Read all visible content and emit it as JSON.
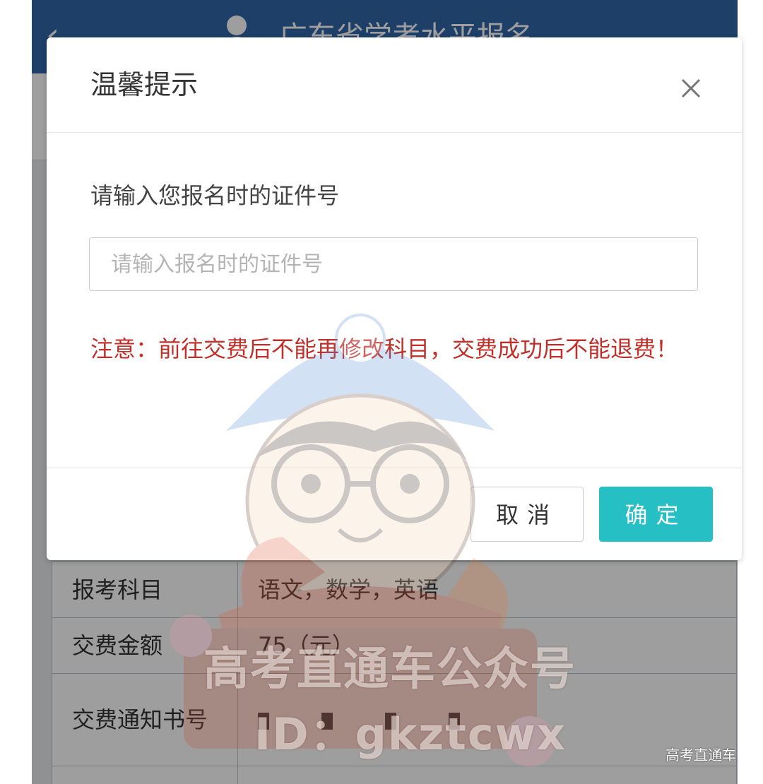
{
  "app": {
    "back_glyph": "‹",
    "title": "广东省学考水平报名"
  },
  "table": {
    "rows": [
      {
        "label": "报考科目",
        "value": "语文，数学，英语"
      },
      {
        "label": "交费金额",
        "value": "75（元）"
      },
      {
        "label": "交费通知书号",
        "value": ""
      }
    ]
  },
  "dialog": {
    "title": "温馨提示",
    "close_icon": "close-icon",
    "prompt": "请输入您报名时的证件号",
    "input_value": "",
    "input_placeholder": "请输入报名时的证件号",
    "warning": "注意：前往交费后不能再修改科目，交费成功后不能退费！",
    "cancel_label": "取消",
    "ok_label": "确定"
  },
  "watermark": {
    "line1": "高考直通车公众号",
    "line2": "ID：gkztcwx",
    "corner": "高考直通车"
  },
  "colors": {
    "header": "#2f66a8",
    "primary_button": "#26bfc4",
    "warning_text": "#c0302b"
  }
}
